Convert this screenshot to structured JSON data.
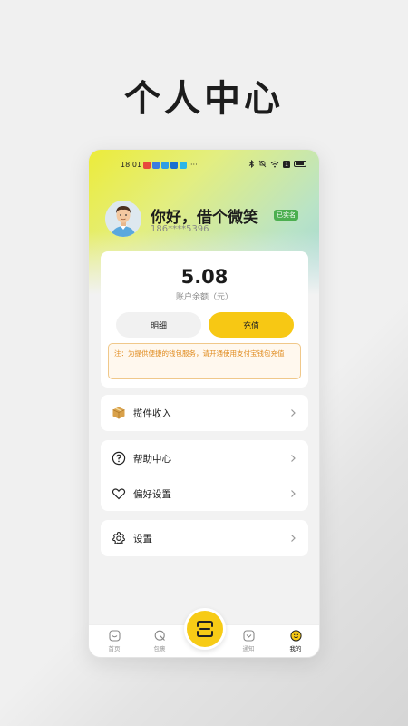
{
  "page": {
    "title": "个人中心"
  },
  "status_bar": {
    "time": "18:01",
    "more": "···",
    "battery": "battery-icon"
  },
  "profile": {
    "greeting": "你好，借个微笑",
    "badge": "已实名",
    "phone": "186****5396"
  },
  "wallet": {
    "balance": "5.08",
    "balance_label": "账户余额（元）",
    "detail_button": "明细",
    "recharge_button": "充值",
    "notice": "注：为提供便捷的钱包服务，请开通使用支付宝钱包充值"
  },
  "menu": {
    "income": {
      "label": "揽件收入",
      "icon": "package-icon"
    },
    "help": {
      "label": "帮助中心",
      "icon": "question-icon"
    },
    "preferences": {
      "label": "偏好设置",
      "icon": "heart-icon"
    },
    "settings": {
      "label": "设置",
      "icon": "gear-icon"
    }
  },
  "tabbar": {
    "home": "首页",
    "parcel": "包裹",
    "notify": "通知",
    "mine": "我的",
    "active": "mine"
  },
  "colors": {
    "accent": "#f7c814",
    "badge": "#4caf50",
    "notice_text": "#e08a1c"
  }
}
